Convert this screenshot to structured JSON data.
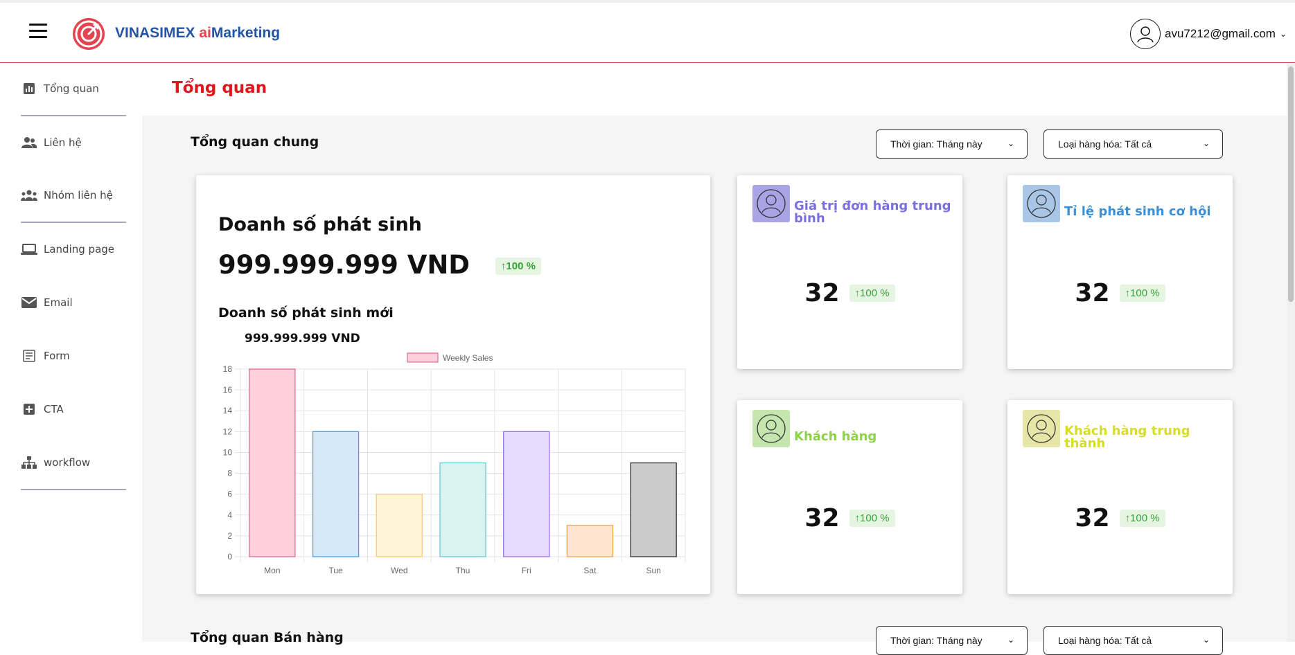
{
  "brand": {
    "name": "VINASIMEX",
    "ai": "ai",
    "suffix": "Marketing"
  },
  "user": {
    "email": "avu7212@gmail.com"
  },
  "sidebar": {
    "items": [
      {
        "label": "Tổng quan",
        "icon": "bar-chart-icon"
      },
      {
        "label": "Liên hệ",
        "icon": "contacts-icon"
      },
      {
        "label": "Nhóm liên hệ",
        "icon": "group-icon"
      },
      {
        "label": "Landing page",
        "icon": "laptop-icon"
      },
      {
        "label": "Email",
        "icon": "mail-icon"
      },
      {
        "label": "Form",
        "icon": "form-icon"
      },
      {
        "label": "CTA",
        "icon": "plus-box-icon"
      },
      {
        "label": "workflow",
        "icon": "workflow-icon"
      }
    ]
  },
  "page": {
    "title": "Tổng quan"
  },
  "overview": {
    "title": "Tổng quan chung",
    "filter_time": "Thời gian: Tháng này",
    "filter_goods": "Loại hàng hóa: Tất cả",
    "revenue": {
      "label": "Doanh số phát sinh",
      "value": "999.999.999 VND",
      "change": "100 %",
      "new_label": "Doanh số phát sinh mới",
      "new_value": "999.999.999  VND"
    },
    "stats": [
      {
        "title": "Giá trị đơn hàng trung bình",
        "value": "32",
        "change": "100 %",
        "color": "#7b6fe0",
        "icon_bg": "#a9a4e6"
      },
      {
        "title": "Tỉ lệ phát sinh cơ hội",
        "value": "32",
        "change": "100 %",
        "color": "#3a8fd9",
        "icon_bg": "#a9c6e6"
      },
      {
        "title": "Khách hàng",
        "value": "32",
        "change": "100 %",
        "color": "#8ed14a",
        "icon_bg": "#c6e6b0"
      },
      {
        "title": "Khách hàng trung thành",
        "value": "32",
        "change": "100 %",
        "color": "#d6dc2a",
        "icon_bg": "#e6e6a9"
      }
    ]
  },
  "sales": {
    "title": "Tổng quan Bán hàng",
    "filter_time": "Thời gian: Tháng này",
    "filter_goods": "Loại hàng hóa: Tất cả"
  },
  "chart_data": {
    "type": "bar",
    "categories": [
      "Mon",
      "Tue",
      "Wed",
      "Thu",
      "Fri",
      "Sat",
      "Sun"
    ],
    "series": [
      {
        "name": "Weekly Sales",
        "values": [
          18,
          12,
          6,
          9,
          12,
          3,
          9
        ]
      }
    ],
    "ylim": [
      0,
      18
    ],
    "yticks": [
      0,
      2,
      4,
      6,
      8,
      10,
      12,
      14,
      16,
      18
    ],
    "legend": "top",
    "grid": true,
    "bar_fill": [
      "#ffd0de",
      "#d5eaf9",
      "#fff3d8",
      "#d9f2f2",
      "#e6dcfd",
      "#ffe6d1",
      "#cbcbcb"
    ],
    "bar_stroke": [
      "#e36a94",
      "#4aa2e6",
      "#f6cf6c",
      "#6cc9c9",
      "#9b6ff2",
      "#f2a45a",
      "#333333"
    ]
  }
}
